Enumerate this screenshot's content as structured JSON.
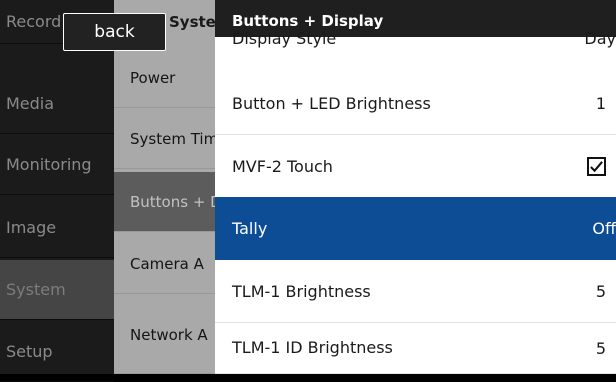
{
  "sidebar": {
    "items": [
      {
        "label": "Record"
      },
      {
        "label": "Media"
      },
      {
        "label": "Monitoring"
      },
      {
        "label": "Image"
      },
      {
        "label": "System",
        "selected": true
      },
      {
        "label": "Setup"
      }
    ]
  },
  "submenu": {
    "header": "System",
    "items": [
      {
        "label": "Power"
      },
      {
        "label": "System Time"
      },
      {
        "label": "Buttons + Display",
        "selected": true
      },
      {
        "label": "Camera A"
      },
      {
        "label": "Network A"
      }
    ]
  },
  "back_button": {
    "label": "back"
  },
  "panel": {
    "title": "Buttons + Display",
    "partial_row": {
      "label": "Display Style",
      "value": "Day"
    },
    "rows": [
      {
        "label": "Button + LED Brightness",
        "value": "1",
        "type": "value"
      },
      {
        "label": "MVF-2 Touch",
        "checked": true,
        "type": "checkbox",
        "icon": "checkmark-icon"
      },
      {
        "label": "Tally",
        "value": "Off",
        "type": "value",
        "selected": true
      },
      {
        "label": "TLM-1 Brightness",
        "value": "5",
        "type": "value"
      },
      {
        "label": "TLM-1 ID Brightness",
        "value": "5",
        "type": "value"
      }
    ]
  },
  "colors": {
    "highlight": "#0d4d96",
    "header_bg": "#1f1f1f",
    "sidebar_bg": "#1b1b1b",
    "submenu_bg": "#a9a9a9"
  }
}
